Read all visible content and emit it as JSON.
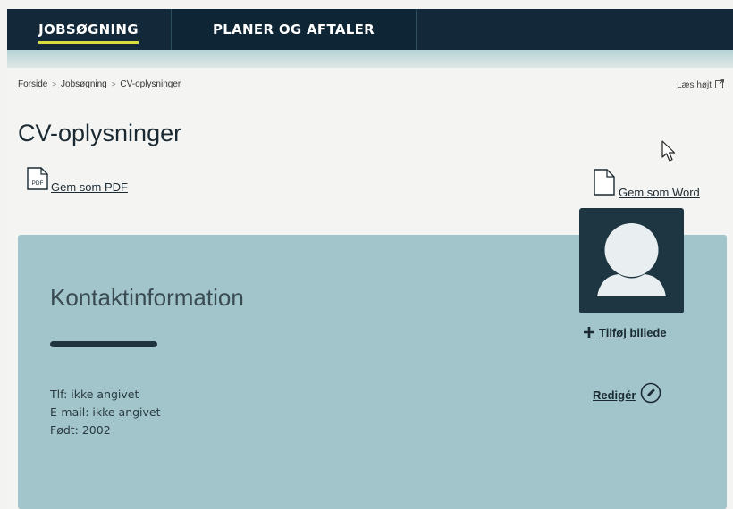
{
  "nav": {
    "tabs": [
      {
        "label": "JOBSØGNING",
        "active": true
      },
      {
        "label": "PLANER OG AFTALER",
        "active": false
      }
    ]
  },
  "breadcrumb": {
    "items": [
      "Forside",
      "Jobsøgning",
      "CV-oplysninger"
    ],
    "separator": ">"
  },
  "read_aloud": {
    "label": "Læs højt"
  },
  "page": {
    "title": "CV-oplysninger"
  },
  "actions": {
    "pdf_label": "Gem som PDF",
    "pdf_icon_text": "PDF",
    "word_label": "Gem som Word"
  },
  "contact": {
    "title": "Kontaktinformation",
    "phone": "Tlf: ikke angivet",
    "email": "E-mail: ikke angivet",
    "born": "Født: 2002",
    "add_photo_label": "Tilføj billede",
    "edit_label": "Redigér"
  },
  "colors": {
    "nav_bg": "#13293a",
    "active_underline": "#d9dc3c",
    "panel_bg": "#a1c5cb",
    "avatar_bg": "#1e3642"
  },
  "icons": {
    "pdf": "pdf-file-icon",
    "word": "document-icon",
    "external": "external-link-icon",
    "avatar": "user-silhouette-icon",
    "plus": "plus-icon",
    "edit": "pencil-circle-icon",
    "cursor": "mouse-pointer-icon"
  }
}
